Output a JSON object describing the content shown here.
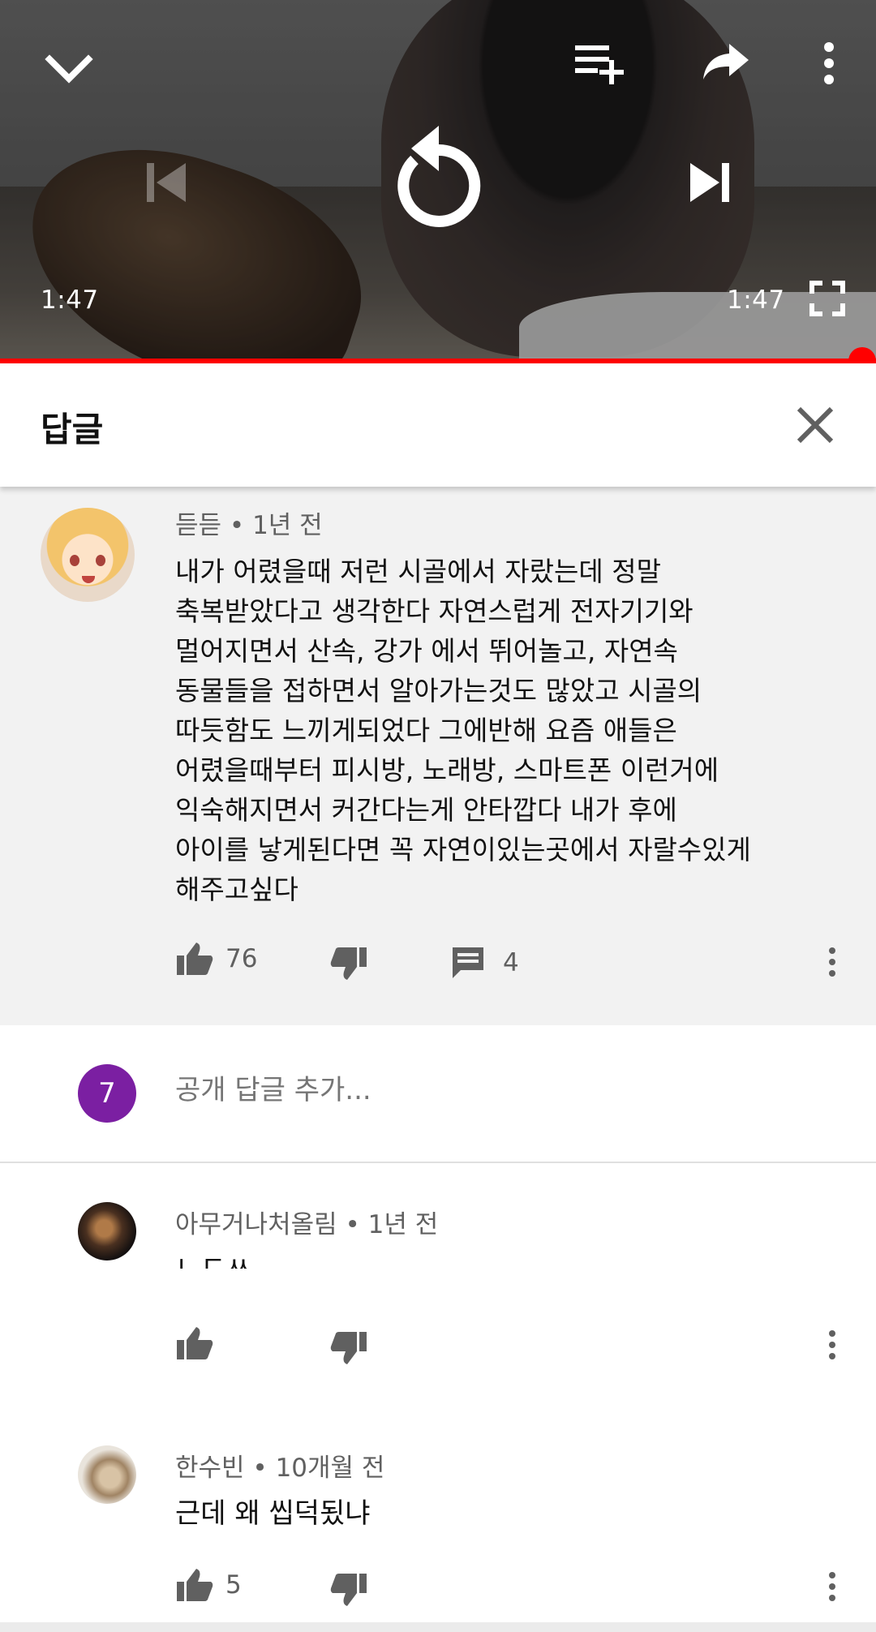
{
  "player": {
    "current_time": "1:47",
    "duration": "1:47",
    "progress": 1.0,
    "accent_color": "#ff0000",
    "icons": {
      "collapse": "chevron-down-icon",
      "add_to_playlist": "playlist-add-icon",
      "share": "share-icon",
      "more": "more-vert-icon",
      "previous": "skip-previous-icon",
      "replay": "replay-icon",
      "next": "skip-next-icon",
      "fullscreen": "fullscreen-icon"
    }
  },
  "reply_panel": {
    "title": "답글",
    "close_icon": "close-icon"
  },
  "parent_comment": {
    "author": "듣듣",
    "age": "1년 전",
    "text": "내가 어렸을때 저런 시골에서 자랐는데 정말\n축복받았다고 생각한다 자연스럽게 전자기기와\n멀어지면서 산속, 강가 에서 뛰어놀고, 자연속\n동물들을 접하면서 알아가는것도 많았고 시골의\n따듯함도 느끼게되었다 그에반해 요즘 애들은\n어렸을때부터 피시방, 노래방, 스마트폰 이런거에\n익숙해지면서 커간다는게 안타깝다 내가 후에\n아이를 낳게된다면 꼭 자연이있는곳에서 자랄수있게\n해주고싶다",
    "likes": "76",
    "replies": "4"
  },
  "add_reply": {
    "user_initial": "7",
    "user_color": "#7b1fa2",
    "placeholder": "공개 답글 추가..."
  },
  "replies": [
    {
      "author": "아무거나처올림",
      "age": "1년 전",
      "text": "ㄴㄷㅆ",
      "likes": ""
    },
    {
      "author": "한수빈",
      "age": "10개월 전",
      "text": "근데 왜 씹덕됬냐",
      "likes": "5"
    }
  ],
  "separator": "•"
}
